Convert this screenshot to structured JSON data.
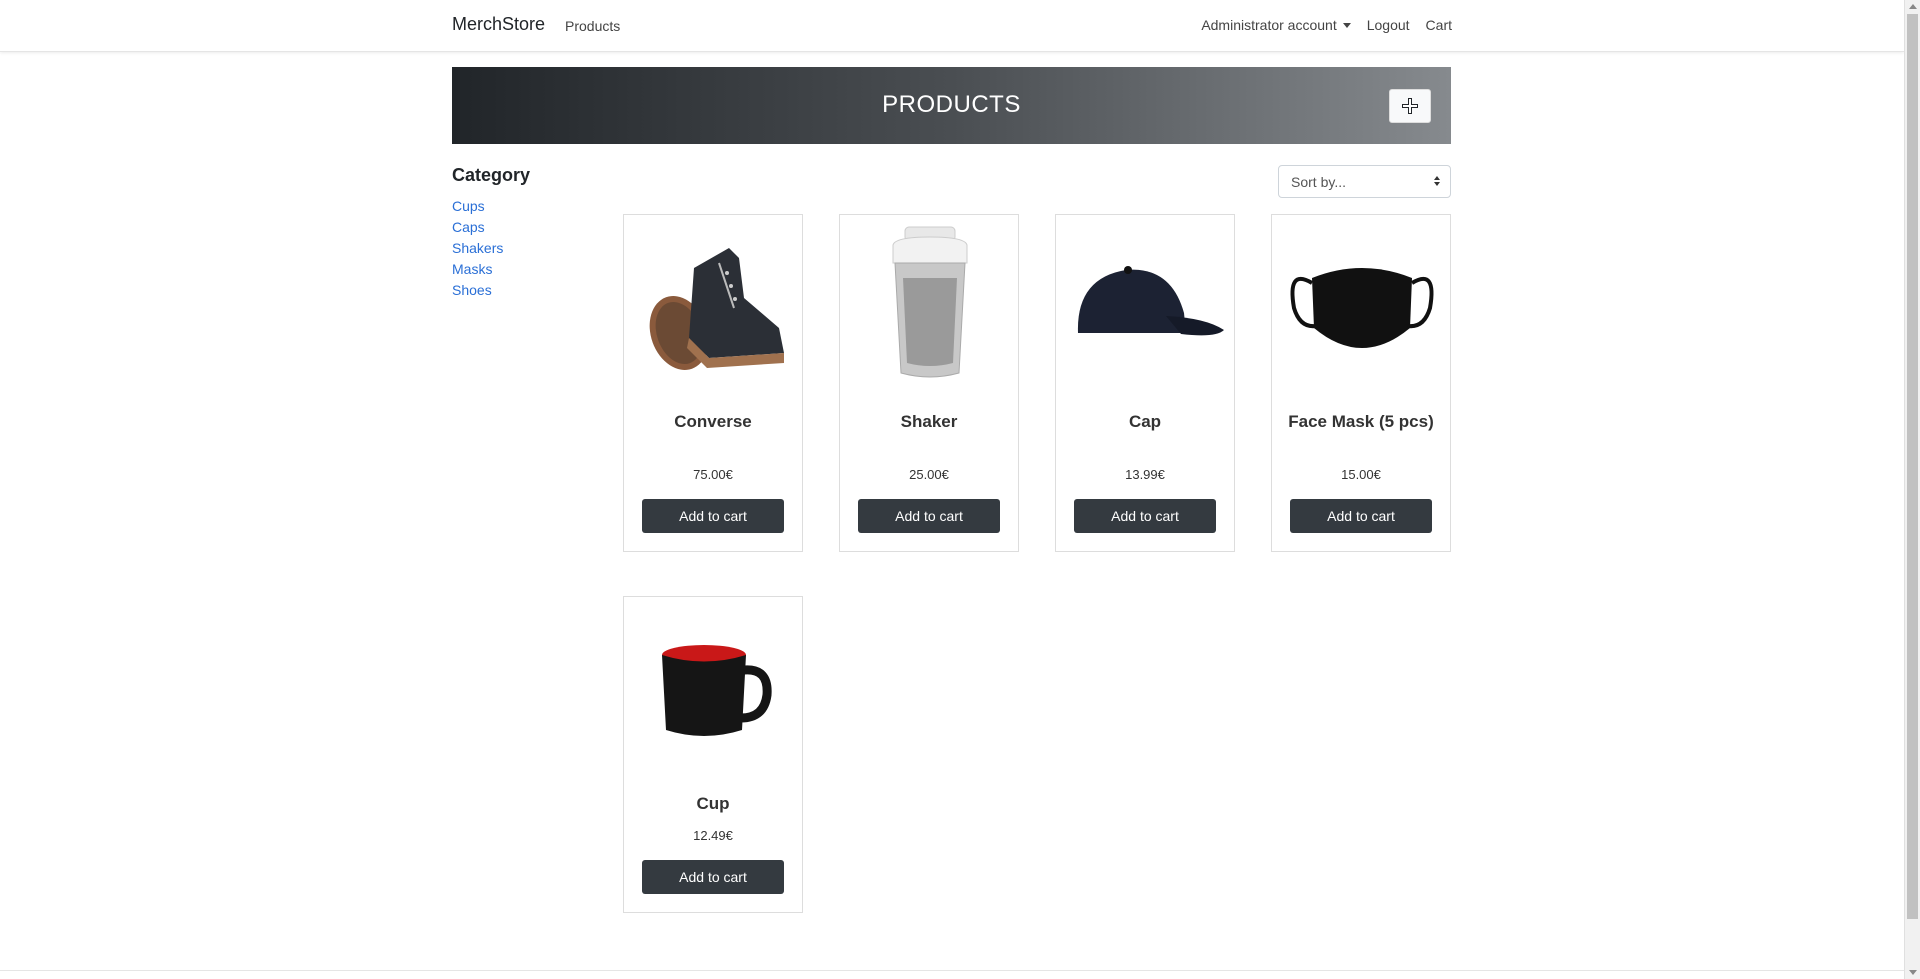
{
  "navbar": {
    "brand": "MerchStore",
    "products_link": "Products",
    "account_label": "Administrator account",
    "logout_label": "Logout",
    "cart_label": "Cart"
  },
  "banner": {
    "title": "PRODUCTS",
    "add_icon": "plus-icon"
  },
  "categories": {
    "title": "Category",
    "items": [
      "Cups",
      "Caps",
      "Shakers",
      "Masks",
      "Shoes"
    ]
  },
  "sort": {
    "selected": "Sort by..."
  },
  "products": [
    {
      "name": "Converse",
      "price": "75.00€",
      "button": "Add to cart",
      "image": "converse-shoe"
    },
    {
      "name": "Shaker",
      "price": "25.00€",
      "button": "Add to cart",
      "image": "shaker-bottle"
    },
    {
      "name": "Cap",
      "price": "13.99€",
      "button": "Add to cart",
      "image": "baseball-cap"
    },
    {
      "name": "Face Mask (5 pcs)",
      "price": "15.00€",
      "button": "Add to cart",
      "image": "face-mask"
    },
    {
      "name": "Cup",
      "price": "12.49€",
      "button": "Add to cart",
      "image": "mug"
    }
  ],
  "colors": {
    "link": "#2a6fd6",
    "button_dark": "#343a40",
    "banner_start": "#212529",
    "banner_end": "#868a8e"
  }
}
